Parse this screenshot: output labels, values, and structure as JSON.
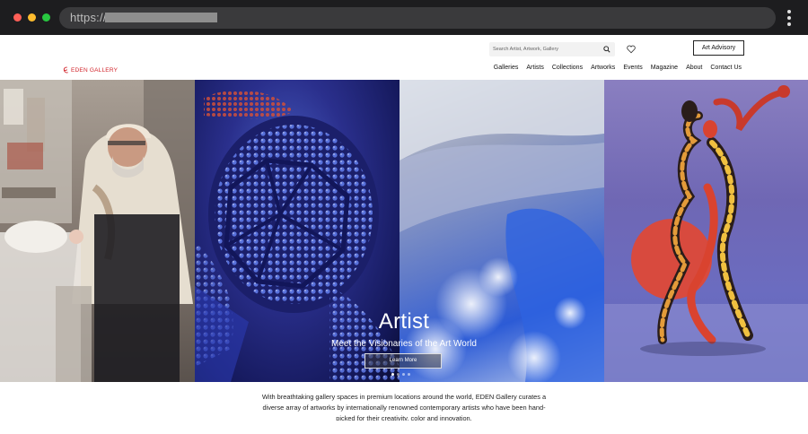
{
  "browser": {
    "url_prefix": "https://"
  },
  "header": {
    "search_placeholder": "Search Artist, Artwork, Gallery",
    "advisory_label": "Art Advisory",
    "logo_text": "EDEN GALLERY",
    "nav": [
      "Galleries",
      "Artists",
      "Collections",
      "Artworks",
      "Events",
      "Magazine",
      "About",
      "Contact Us"
    ]
  },
  "hero": {
    "title": "Artist",
    "subtitle": "Meet the Visionaries of the Art World",
    "button_label": "Learn More",
    "slides_count": 4,
    "active_slide": 1
  },
  "intro": {
    "text": "With breathtaking gallery spaces in premium locations around the world, EDEN Gallery curates a diverse array of artworks by internationally renowned contemporary artists who have been hand-picked for their creativity, color and innovation."
  },
  "colors": {
    "brand": "#d2232a",
    "chrome_bg": "#1d1d1f"
  }
}
